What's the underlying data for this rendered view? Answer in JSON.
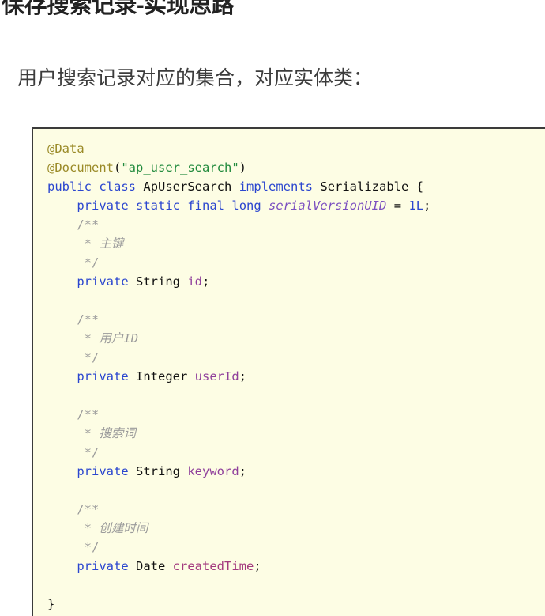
{
  "page": {
    "title": "保存搜索记录-实现思路",
    "subtitle": "用户搜索记录对应的集合，对应实体类："
  },
  "theme": {
    "code_background": "#fdfde4",
    "code_border": "#3b3b3b",
    "page_background": "#ffffff",
    "title_color": "#222222",
    "subtitle_color": "#3c3c3c",
    "keyword_color": "#2b46cf",
    "annotation_color": "#9a8a27",
    "string_color": "#208a3c",
    "field_color": "#8f3f9b",
    "comment_color": "#9b9b9b",
    "constant_color": "#7b4fc0"
  },
  "code": {
    "language": "java",
    "class_name": "ApUserSearch",
    "collection_name": "ap_user_search",
    "lines": [
      "@Data",
      "@Document(\"ap_user_search\")",
      "public class ApUserSearch implements Serializable {",
      "    private static final long serialVersionUID = 1L;",
      "    /**",
      "     * 主键",
      "     */",
      "    private String id;",
      "",
      "    /**",
      "     * 用户ID",
      "     */",
      "    private Integer userId;",
      "",
      "    /**",
      "     * 搜索词",
      "     */",
      "    private String keyword;",
      "",
      "    /**",
      "     * 创建时间",
      "     */",
      "    private Date createdTime;",
      "",
      "}"
    ],
    "annotations": [
      "@Data",
      "@Document"
    ],
    "fields": [
      {
        "comment": "主键",
        "modifier": "private",
        "type": "String",
        "name": "id"
      },
      {
        "comment": "用户ID",
        "modifier": "private",
        "type": "Integer",
        "name": "userId"
      },
      {
        "comment": "搜索词",
        "modifier": "private",
        "type": "String",
        "name": "keyword"
      },
      {
        "comment": "创建时间",
        "modifier": "private",
        "type": "Date",
        "name": "createdTime"
      }
    ],
    "constant": {
      "modifier": "private static final",
      "type": "long",
      "name": "serialVersionUID",
      "value": "1L"
    },
    "tokens": {
      "ann_data": "@Data",
      "ann_document": "@Document",
      "paren_open": "(",
      "paren_close": ")",
      "str_collection": "\"ap_user_search\"",
      "kw_public": "public",
      "kw_class": "class",
      "cls_name": "ApUserSearch",
      "kw_implements": "implements",
      "type_serializable": "Serializable",
      "brace_open": "{",
      "brace_close": "}",
      "kw_private": "private",
      "kw_static": "static",
      "kw_final": "final",
      "type_long": "long",
      "const_name": "serialVersionUID",
      "op_eq": "=",
      "num_1l": "1L",
      "semicolon": ";",
      "cmt_open": "/**",
      "cmt_star": "*",
      "cmt_close": "*/",
      "cmt_1": "主键",
      "cmt_2": "用户ID",
      "cmt_3": "搜索词",
      "cmt_4": "创建时间",
      "type_string": "String",
      "type_integer": "Integer",
      "type_date": "Date",
      "fld_id": "id",
      "fld_userid": "userId",
      "fld_keyword": "keyword",
      "fld_createdtime": "createdTime"
    }
  }
}
